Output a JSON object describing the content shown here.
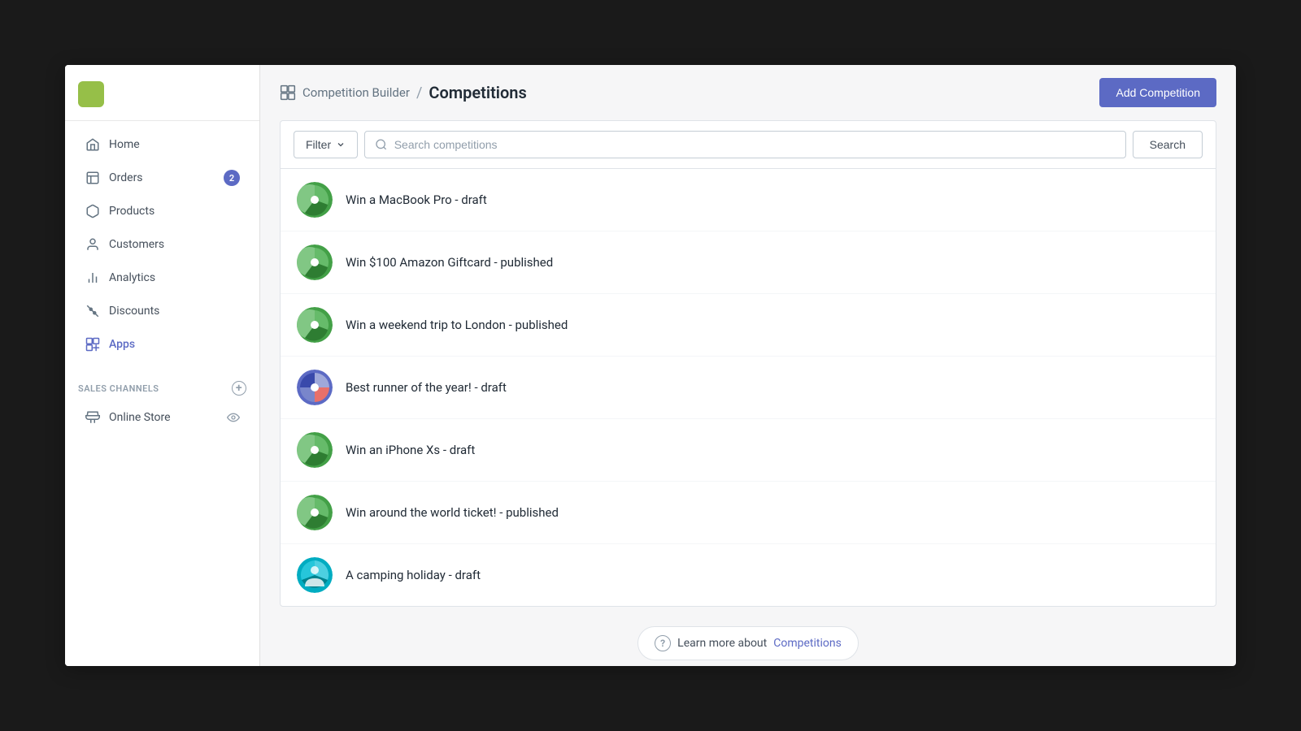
{
  "sidebar": {
    "items": [
      {
        "id": "home",
        "label": "Home",
        "icon": "home-icon"
      },
      {
        "id": "orders",
        "label": "Orders",
        "icon": "orders-icon",
        "badge": "2"
      },
      {
        "id": "products",
        "label": "Products",
        "icon": "products-icon"
      },
      {
        "id": "customers",
        "label": "Customers",
        "icon": "customers-icon"
      },
      {
        "id": "analytics",
        "label": "Analytics",
        "icon": "analytics-icon"
      },
      {
        "id": "discounts",
        "label": "Discounts",
        "icon": "discounts-icon"
      },
      {
        "id": "apps",
        "label": "Apps",
        "icon": "apps-icon",
        "active": true
      }
    ],
    "sales_channels_label": "SALES CHANNELS",
    "online_store_label": "Online Store"
  },
  "header": {
    "builder_label": "Competition Builder",
    "separator": "/",
    "page_title": "Competitions",
    "add_button_label": "Add Competition"
  },
  "search": {
    "filter_label": "Filter",
    "placeholder": "Search competitions",
    "submit_label": "Search"
  },
  "competitions": [
    {
      "id": 1,
      "name": "Win a MacBook Pro - draft",
      "avatar_type": "green-pie"
    },
    {
      "id": 2,
      "name": "Win $100 Amazon Giftcard - published",
      "avatar_type": "green-pie"
    },
    {
      "id": 3,
      "name": "Win a weekend trip to London - published",
      "avatar_type": "green-pie"
    },
    {
      "id": 4,
      "name": "Best runner of the year! - draft",
      "avatar_type": "blue-person"
    },
    {
      "id": 5,
      "name": "Win an iPhone Xs - draft",
      "avatar_type": "green-pie"
    },
    {
      "id": 6,
      "name": "Win around the world ticket! - published",
      "avatar_type": "green-pie"
    },
    {
      "id": 7,
      "name": "A camping holiday - draft",
      "avatar_type": "teal-person"
    }
  ],
  "footer": {
    "learn_text": "Learn more about",
    "learn_link": "Competitions"
  },
  "colors": {
    "primary": "#5c6ac4",
    "sidebar_bg": "#ffffff",
    "main_bg": "#f6f6f7"
  }
}
